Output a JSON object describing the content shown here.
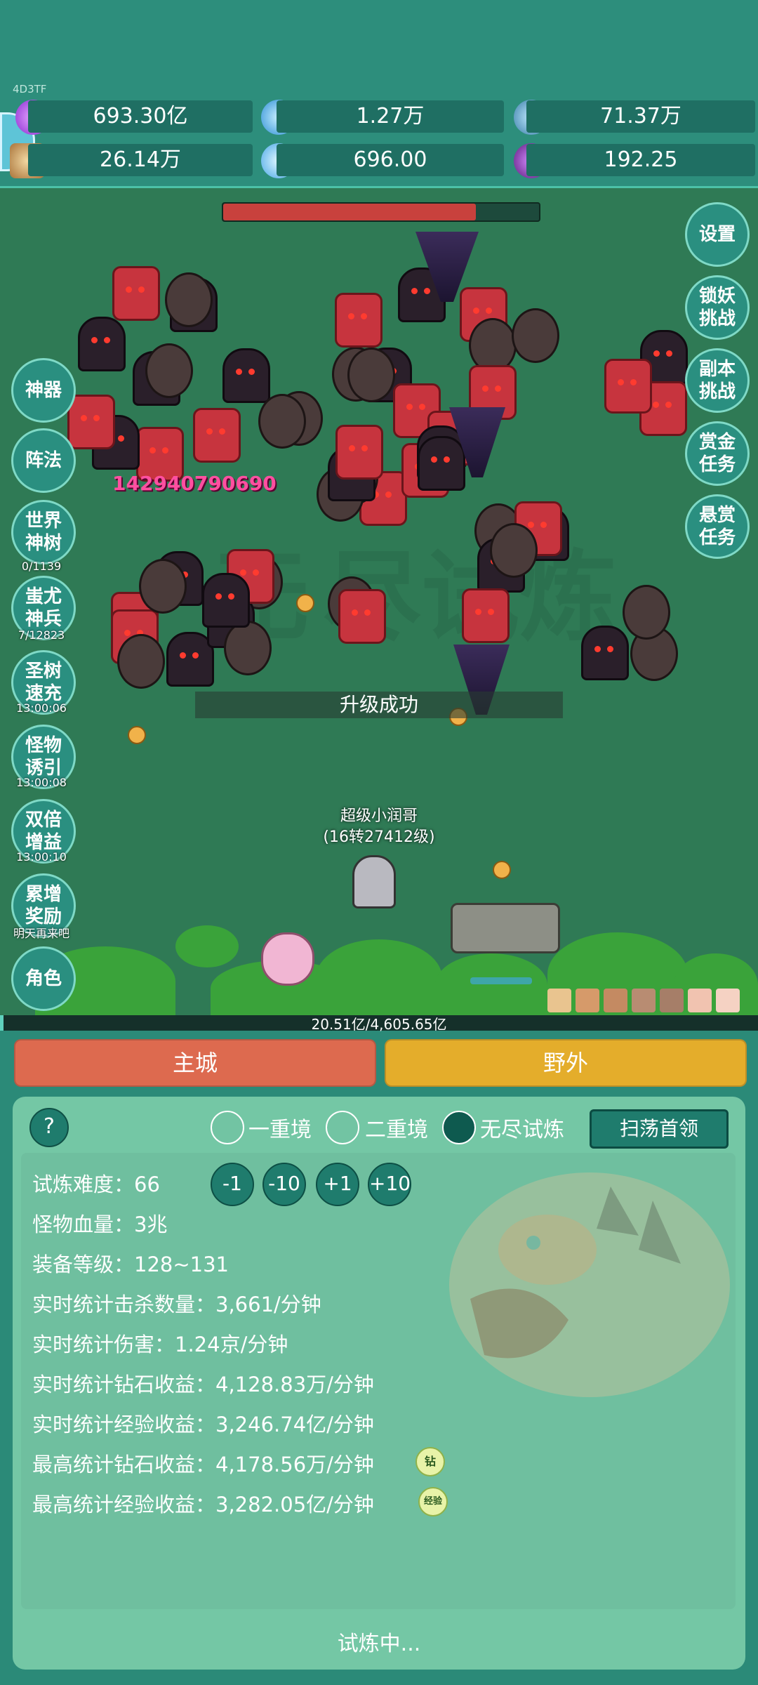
{
  "header": {
    "tag": "4D3TF",
    "resources": [
      {
        "icon": "purple-gem-icon",
        "value": "693.30亿"
      },
      {
        "icon": "blue-crystal-icon",
        "value": "1.27万"
      },
      {
        "icon": "blue-orb-icon",
        "value": "71.37万"
      },
      {
        "icon": "scroll-icon",
        "value": "26.14万"
      },
      {
        "icon": "ice-crystal-icon",
        "value": "696.00"
      },
      {
        "icon": "purple-potion-icon",
        "value": "192.25"
      }
    ]
  },
  "battle": {
    "boss_hp_fraction": 0.8,
    "damage_text": "142940790690",
    "levelup_text": "升级成功",
    "player_name": "超级小润哥",
    "player_level": "(16转27412级)",
    "exp_text": "20.51亿/4,605.65亿",
    "exp_fraction": 0.0045
  },
  "left_menu": [
    {
      "id": "artifact",
      "label": "神器"
    },
    {
      "id": "formation",
      "label": "阵法"
    },
    {
      "id": "world-tree",
      "label": "世界神树",
      "sub": "0/1139"
    },
    {
      "id": "chiyou",
      "label": "蚩尤神兵",
      "sub": "7/12823"
    },
    {
      "id": "tree-charge",
      "label": "圣树速充",
      "sub": "13:00:06"
    },
    {
      "id": "monster-lure",
      "label": "怪物诱引",
      "sub": "13:00:08"
    },
    {
      "id": "double-gain",
      "label": "双倍增益",
      "sub": "13:00:10"
    },
    {
      "id": "cumulative-reward",
      "label": "累增奖励",
      "sub": "明天再来吧"
    },
    {
      "id": "character",
      "label": "角色"
    }
  ],
  "right_menu": [
    {
      "id": "settings",
      "label": "设置"
    },
    {
      "id": "lock-demon",
      "label": "锁妖挑战"
    },
    {
      "id": "dungeon",
      "label": "副本挑战"
    },
    {
      "id": "gold-task",
      "label": "赏金任务"
    },
    {
      "id": "bounty-task",
      "label": "悬赏任务"
    }
  ],
  "tabs": {
    "main_city": "主城",
    "wild": "野外"
  },
  "trial": {
    "help": "?",
    "modes": [
      "一重境",
      "二重境",
      "无尽试炼"
    ],
    "selected_mode": "无尽试炼",
    "sweep_button": "扫荡首领",
    "adjust": [
      "-1",
      "-10",
      "+1",
      "+10"
    ],
    "stats": [
      "试炼难度：66",
      "怪物血量：3兆",
      "装备等级：128~131",
      "实时统计击杀数量：3,661/分钟",
      "实时统计伤害：1.24京/分钟",
      "实时统计钻石收益：4,128.83万/分钟",
      "实时统计经验收益：3,246.74亿/分钟",
      "最高统计钻石收益：4,178.56万/分钟",
      "最高统计经验收益：3,282.05亿/分钟"
    ],
    "badge_diamond": "钻",
    "badge_exp": "经验",
    "status": "试炼中..."
  },
  "colors": {
    "main_city": "#dd6a4f",
    "wild": "#e4ad2b",
    "hp": "#c8413d"
  }
}
